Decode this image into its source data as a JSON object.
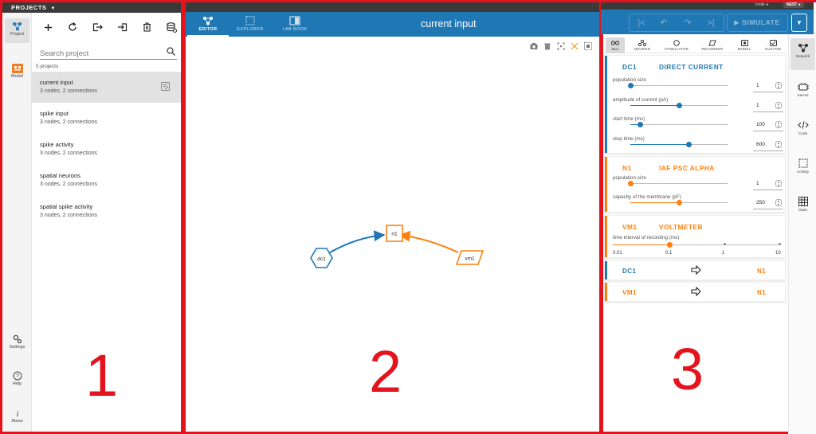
{
  "left": {
    "header": "PROJECTS",
    "rail": [
      {
        "label": "Project",
        "icon": "network-icon"
      },
      {
        "label": "Model",
        "icon": "model-icon"
      },
      {
        "label": "Settings",
        "icon": "settings-icon"
      },
      {
        "label": "Help",
        "icon": "help-icon"
      },
      {
        "label": "About",
        "icon": "info-icon"
      }
    ],
    "search_placeholder": "Search project",
    "count": "5 projects",
    "projects": [
      {
        "name": "current input",
        "desc": "3 nodes, 2 connections"
      },
      {
        "name": "spike input",
        "desc": "3 nodes, 2 connections"
      },
      {
        "name": "spike activity",
        "desc": "3 nodes, 2 connections"
      },
      {
        "name": "spatial neurons",
        "desc": "3 nodes, 2 connections"
      },
      {
        "name": "spatial spike activity",
        "desc": "3 nodes, 2 connections"
      }
    ]
  },
  "tabs": [
    {
      "label": "EDITOR"
    },
    {
      "label": "EXPLORER"
    },
    {
      "label": "LAB BOOK"
    }
  ],
  "title": "current input",
  "header_right": {
    "badge_insite": "Insite",
    "badge_nest": "NEST",
    "simulate": "SIMULATE"
  },
  "graph": {
    "nodes": [
      {
        "id": "dc1",
        "label": "dc1",
        "color": "#1f77b4"
      },
      {
        "id": "n1",
        "label": "n1",
        "color": "#ff7f0e"
      },
      {
        "id": "vm1",
        "label": "vm1",
        "color": "#ff7f0e"
      }
    ]
  },
  "filters": [
    "ALL",
    "NEURON",
    "STIMULATOR",
    "RECORDER",
    "MODEL",
    "CUSTOM"
  ],
  "cards": [
    {
      "id": "DC1",
      "name": "DIRECT CURRENT",
      "color": "#1f77b4",
      "params": [
        {
          "label": "population size",
          "value": "1",
          "fraction": 0.0
        },
        {
          "label": "amplitude of current (pA)",
          "value": "1",
          "fraction": 0.5
        },
        {
          "label": "start time (ms)",
          "value": "100",
          "fraction": 0.1
        },
        {
          "label": "stop time (ms)",
          "value": "600",
          "fraction": 0.6
        }
      ]
    },
    {
      "id": "N1",
      "name": "IAF PSC ALPHA",
      "color": "#ff7f0e",
      "params": [
        {
          "label": "population size",
          "value": "1",
          "fraction": 0.0
        },
        {
          "label": "capacity of the membrane (pF)",
          "value": "250",
          "fraction": 0.5
        }
      ]
    },
    {
      "id": "VM1",
      "name": "VOLTMETER",
      "color": "#ff7f0e",
      "params": [
        {
          "label": "time interval of recording (ms)",
          "ticks": [
            "0.01",
            "0.1",
            "1",
            "10"
          ]
        }
      ]
    }
  ],
  "connections": [
    {
      "from": "DC1",
      "to": "N1",
      "color": "#1f77b4"
    },
    {
      "from": "VM1",
      "to": "N1",
      "color": "#ff7f0e"
    }
  ],
  "vrail": [
    "Network",
    "Kernel",
    "Code",
    "Activity",
    "Stats"
  ],
  "section_numbers": [
    "1",
    "2",
    "3"
  ]
}
